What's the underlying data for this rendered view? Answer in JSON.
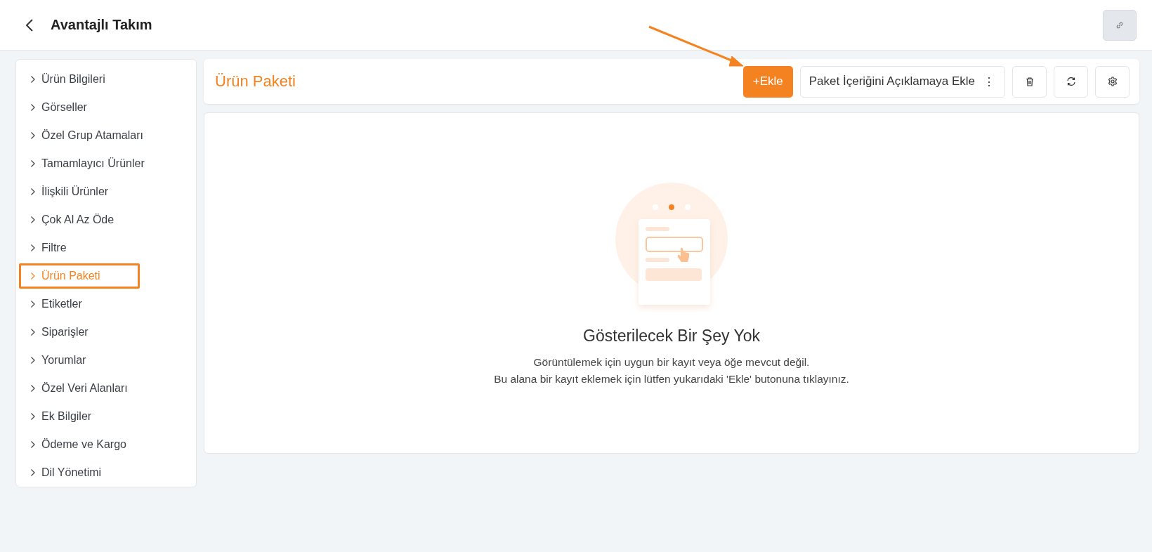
{
  "header": {
    "title": "Avantajlı Takım"
  },
  "sidebar": {
    "items": [
      {
        "label": "Ürün Bilgileri",
        "selected": false
      },
      {
        "label": "Görseller",
        "selected": false
      },
      {
        "label": "Özel Grup Atamaları",
        "selected": false
      },
      {
        "label": "Tamamlayıcı Ürünler",
        "selected": false
      },
      {
        "label": "İlişkili Ürünler",
        "selected": false
      },
      {
        "label": "Çok Al Az Öde",
        "selected": false
      },
      {
        "label": "Filtre",
        "selected": false
      },
      {
        "label": "Ürün Paketi",
        "selected": true
      },
      {
        "label": "Etiketler",
        "selected": false
      },
      {
        "label": "Siparişler",
        "selected": false
      },
      {
        "label": "Yorumlar",
        "selected": false
      },
      {
        "label": "Özel Veri Alanları",
        "selected": false
      },
      {
        "label": "Ek Bilgiler",
        "selected": false
      },
      {
        "label": "Ödeme ve Kargo",
        "selected": false
      },
      {
        "label": "Dil Yönetimi",
        "selected": false
      }
    ]
  },
  "panel": {
    "title": "Ürün Paketi",
    "add_button": "+Ekle",
    "menu_button": "Paket İçeriğini Açıklamaya Ekle",
    "menu_glyph": "⋮"
  },
  "empty_state": {
    "title": "Gösterilecek Bir Şey Yok",
    "lines": [
      "Görüntülemek için uygun bir kayıt veya öğe mevcut değil.",
      "Bu alana bir kayıt eklemek için lütfen yukarıdaki 'Ekle' butonuna tıklayınız."
    ]
  }
}
